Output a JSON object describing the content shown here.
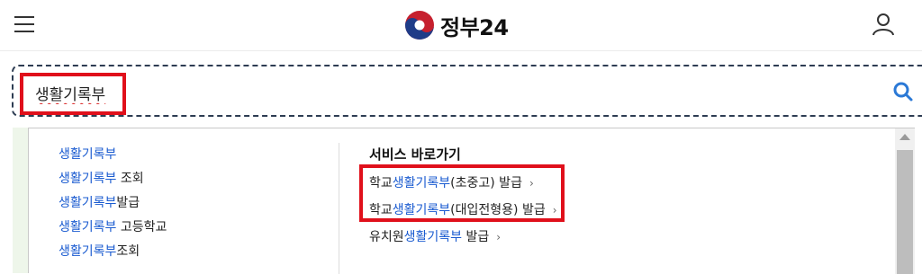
{
  "header": {
    "menu_icon": "hamburger-menu-icon",
    "logo_text": "정부24",
    "logo_icon": "taegeuk-emblem",
    "user_icon": "user-icon"
  },
  "search": {
    "value": "생활기록부",
    "search_icon": "search-icon",
    "accent_color": "#2b79d6"
  },
  "suggestions": [
    {
      "keyword": "생활기록부",
      "suffix": ""
    },
    {
      "keyword": "생활기록부",
      "suffix": " 조회"
    },
    {
      "keyword": "생활기록부",
      "suffix": "발급"
    },
    {
      "keyword": "생활기록부",
      "suffix": " 고등학교"
    },
    {
      "keyword": "생활기록부",
      "suffix": "조회"
    }
  ],
  "shortcuts": {
    "heading": "서비스 바로가기",
    "items": [
      {
        "prefix": "학교",
        "keyword": "생활기록부",
        "suffix": "(초중고) 발급"
      },
      {
        "prefix": "학교",
        "keyword": "생활기록부",
        "suffix": "(대입전형용) 발급"
      },
      {
        "prefix": "유치원",
        "keyword": "생활기록부",
        "suffix": " 발급"
      }
    ],
    "chevron": "›"
  },
  "colors": {
    "keyword_highlight": "#1a5bd0",
    "annotation_box": "#e0101b"
  }
}
